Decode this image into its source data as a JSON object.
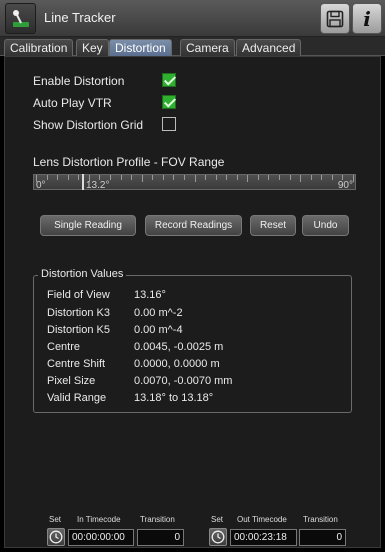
{
  "header": {
    "title": "Line Tracker"
  },
  "tabs": [
    {
      "label": "Calibration"
    },
    {
      "label": "Key"
    },
    {
      "label": "Distortion"
    },
    {
      "label": "Camera"
    },
    {
      "label": "Advanced"
    }
  ],
  "options": {
    "enable_distortion": {
      "label": "Enable Distortion",
      "checked": true
    },
    "auto_play_vtr": {
      "label": "Auto Play VTR",
      "checked": true
    },
    "show_distortion_grid": {
      "label": "Show Distortion Grid",
      "checked": false
    }
  },
  "fov": {
    "label": "Lens Distortion Profile - FOV Range",
    "min_label": "0°",
    "max_label": "90°",
    "current_label": "13.2°",
    "current_value": 13.2,
    "max_value": 90
  },
  "buttons": {
    "single_reading": "Single Reading",
    "record_readings": "Record Readings",
    "reset": "Reset",
    "undo": "Undo"
  },
  "distortion_values": {
    "title": "Distortion Values",
    "rows": [
      {
        "key": "Field of View",
        "value": "13.16°"
      },
      {
        "key": "Distortion K3",
        "value": "0.00 m^-2"
      },
      {
        "key": "Distortion K5",
        "value": "0.00 m^-4"
      },
      {
        "key": "Centre",
        "value": "0.0045, -0.0025 m"
      },
      {
        "key": "Centre Shift",
        "value": "0.0000, 0.0000 m"
      },
      {
        "key": "Pixel Size",
        "value": "0.0070, -0.0070 mm"
      },
      {
        "key": "Valid Range",
        "value": "13.18° to 13.18°"
      }
    ]
  },
  "timecode": {
    "in": {
      "set_label": "Set",
      "timecode_label": "In Timecode",
      "transition_label": "Transition",
      "timecode": "00:00:00:00",
      "transition": "0"
    },
    "out": {
      "set_label": "Set",
      "timecode_label": "Out Timecode",
      "transition_label": "Transition",
      "timecode": "00:00:23:18",
      "transition": "0"
    }
  },
  "colors": {
    "accent_tab": "#5a6f90",
    "check_green": "#2fae2f"
  }
}
